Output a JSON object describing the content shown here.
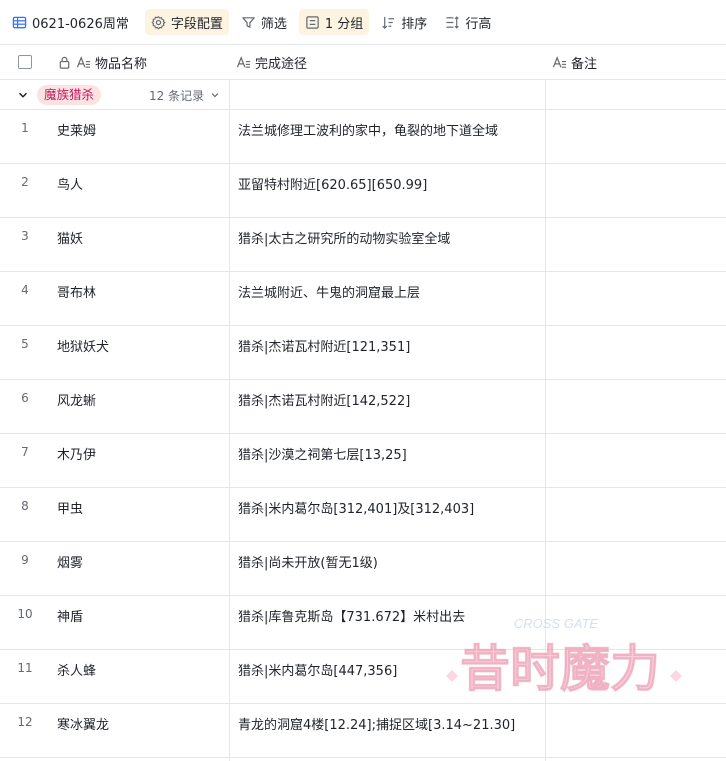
{
  "toolbar": {
    "title": "0621-0626周常",
    "field_config": "字段配置",
    "filter": "筛选",
    "group": "1 分组",
    "sort": "排序",
    "row_height": "行高"
  },
  "columns": {
    "name": "物品名称",
    "route": "完成途径",
    "note": "备注"
  },
  "group": {
    "tag": "魔族猎杀",
    "count": "12 条记录"
  },
  "rows": [
    {
      "num": "1",
      "name": "史莱姆",
      "route": "法兰城修理工波利的家中，龟裂的地下道全域",
      "note": ""
    },
    {
      "num": "2",
      "name": "鸟人",
      "route": "亚留特村附近[620.65][650.99]",
      "note": ""
    },
    {
      "num": "3",
      "name": "猫妖",
      "route": "猎杀|太古之研究所的动物实验室全域",
      "note": ""
    },
    {
      "num": "4",
      "name": "哥布林",
      "route": "法兰城附近、牛鬼的洞窟最上层",
      "note": ""
    },
    {
      "num": "5",
      "name": "地狱妖犬",
      "route": "猎杀|杰诺瓦村附近[121,351]",
      "note": ""
    },
    {
      "num": "6",
      "name": "风龙蜥",
      "route": "猎杀|杰诺瓦村附近[142,522]",
      "note": ""
    },
    {
      "num": "7",
      "name": "木乃伊",
      "route": "猎杀|沙漠之祠第七层[13,25]",
      "note": ""
    },
    {
      "num": "8",
      "name": "甲虫",
      "route": "猎杀|米内葛尔岛[312,401]及[312,403]",
      "note": ""
    },
    {
      "num": "9",
      "name": "烟雾",
      "route": "猎杀|尚未开放(暂无1级)",
      "note": ""
    },
    {
      "num": "10",
      "name": "神盾",
      "route": "猎杀|库鲁克斯岛【731.672】米村出去",
      "note": ""
    },
    {
      "num": "11",
      "name": "杀人蜂",
      "route": "猎杀|米内葛尔岛[447,356]",
      "note": ""
    },
    {
      "num": "12",
      "name": "寒冰翼龙",
      "route": "青龙的洞窟4楼[12.24];捕捉区域[3.14~21.30]",
      "note": ""
    }
  ],
  "watermark": {
    "main": "昔时魔力",
    "sub": "CROSS GATE"
  }
}
